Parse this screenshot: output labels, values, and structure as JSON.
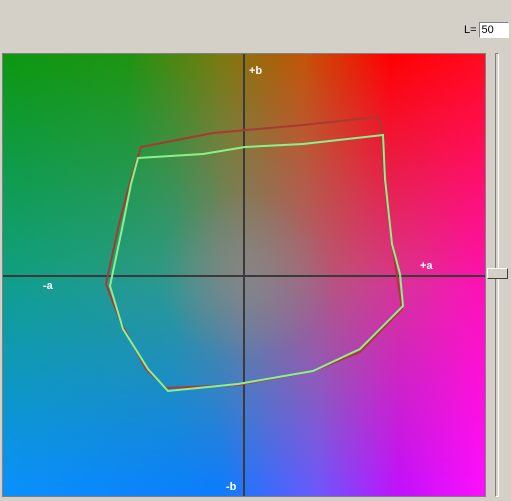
{
  "lightness": {
    "label": "L=",
    "value": "50"
  },
  "axes": {
    "pos_b": "+b",
    "neg_b": "-b",
    "pos_a": "+a",
    "neg_a": "-a"
  },
  "colors": {
    "gamut_primary": "#a83a32",
    "gamut_secondary": "#8ef08a",
    "axis_line": "#3a3a3a"
  }
}
